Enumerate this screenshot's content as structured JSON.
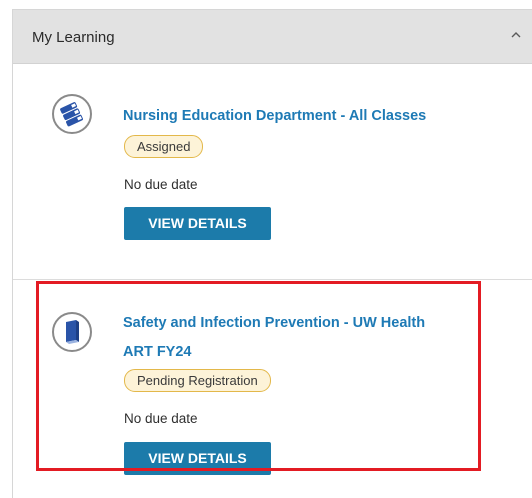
{
  "panel": {
    "title": "My Learning"
  },
  "items": [
    {
      "title": "Nursing Education Department - All Classes",
      "status": "Assigned",
      "due": "No due date",
      "button": "VIEW DETAILS",
      "icon": "books-stack-icon"
    },
    {
      "title_line1": "Safety and Infection Prevention - UW Health",
      "title_line2": "ART FY24",
      "status": "Pending Registration",
      "due": "No due date",
      "button": "VIEW DETAILS",
      "icon": "book-icon"
    }
  ],
  "colors": {
    "link": "#1e7ab5",
    "button": "#1c7baa",
    "badge_bg": "#fdf3d8",
    "badge_border": "#e3b84a",
    "highlight": "#e31b23",
    "header_bg": "#e2e2e2"
  }
}
